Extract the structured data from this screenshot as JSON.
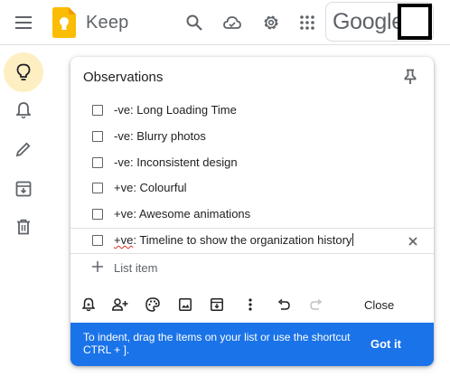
{
  "header": {
    "app_name": "Keep",
    "brand_text": "Google"
  },
  "note": {
    "title": "Observations",
    "items": [
      {
        "text": "-ve: Long Loading Time"
      },
      {
        "text": "-ve: Blurry photos"
      },
      {
        "text": "-ve: Inconsistent design"
      },
      {
        "text": "+ve: Colourful"
      },
      {
        "text": "+ve: Awesome animations"
      }
    ],
    "focused_item": {
      "prefix": "+ve",
      "rest": ": Timeline to show the organization history"
    },
    "add_item_label": "List item"
  },
  "toolbar": {
    "close_label": "Close"
  },
  "banner": {
    "text": "To indent, drag the items on your list or use the shortcut CTRL + ].",
    "action_label": "Got it"
  },
  "colors": {
    "accent": "#1a73e8",
    "active_sidebar": "#feefc3",
    "logo_yellow": "#fbbc04"
  },
  "icons": {
    "header": [
      "menu-icon",
      "keep-logo-icon",
      "search-icon",
      "cloud-sync-icon",
      "gear-icon",
      "apps-grid-icon"
    ],
    "sidebar": [
      "lightbulb-icon",
      "bell-icon",
      "pencil-icon",
      "archive-icon",
      "trash-icon"
    ],
    "toolbar": [
      "remind-icon",
      "collaborator-icon",
      "palette-icon",
      "image-icon",
      "archive-icon",
      "more-icon",
      "undo-icon",
      "redo-icon"
    ]
  }
}
